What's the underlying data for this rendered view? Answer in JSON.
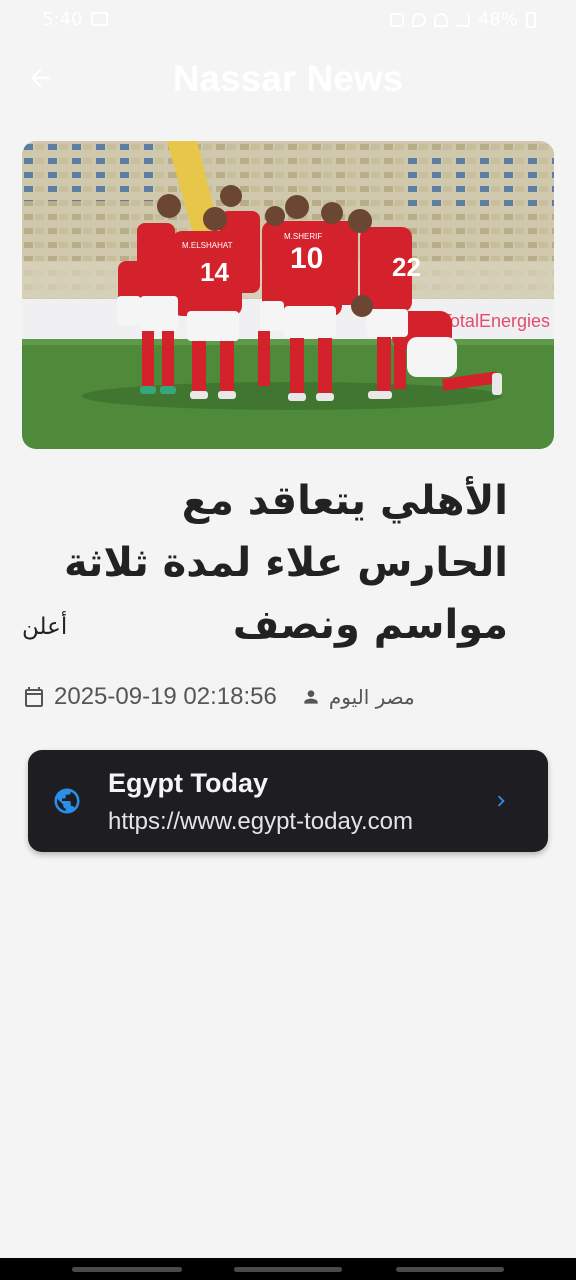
{
  "status_bar": {
    "time": "5:40",
    "battery": "48%",
    "icons": [
      "gallery-icon",
      "vpn-key-icon",
      "location-icon",
      "wifi-icon",
      "signal-icon",
      "battery-icon"
    ]
  },
  "app_bar": {
    "title": "Nassar News",
    "back_icon": "arrow-back-icon"
  },
  "article": {
    "headline": "الأهلي يتعاقد مع الحارس علاء لمدة ثلاثة مواسم ونصف",
    "summary": "أعلن",
    "date": "2025-09-19 02:18:56",
    "author": "مصر اليوم",
    "date_icon": "calendar-icon",
    "author_icon": "person-icon",
    "image": {
      "description_icon": "team-huddle-photo",
      "shirt_numbers": [
        "14",
        "10",
        "22"
      ],
      "jersey_names": [
        "M.ELSHAHAT",
        "M.SHERIF"
      ],
      "sponsor": "TotalEnergies"
    }
  },
  "source": {
    "name": "Egypt Today",
    "url": "https://www.egypt-today.com",
    "icon": "globe-icon",
    "chevron_icon": "chevron-right-icon"
  },
  "colors": {
    "background": "#f4f4f4",
    "card": "#1e1d22",
    "accent": "#2a8fe8",
    "pitch": "#4f8a3a",
    "jersey": "#d3222b"
  }
}
